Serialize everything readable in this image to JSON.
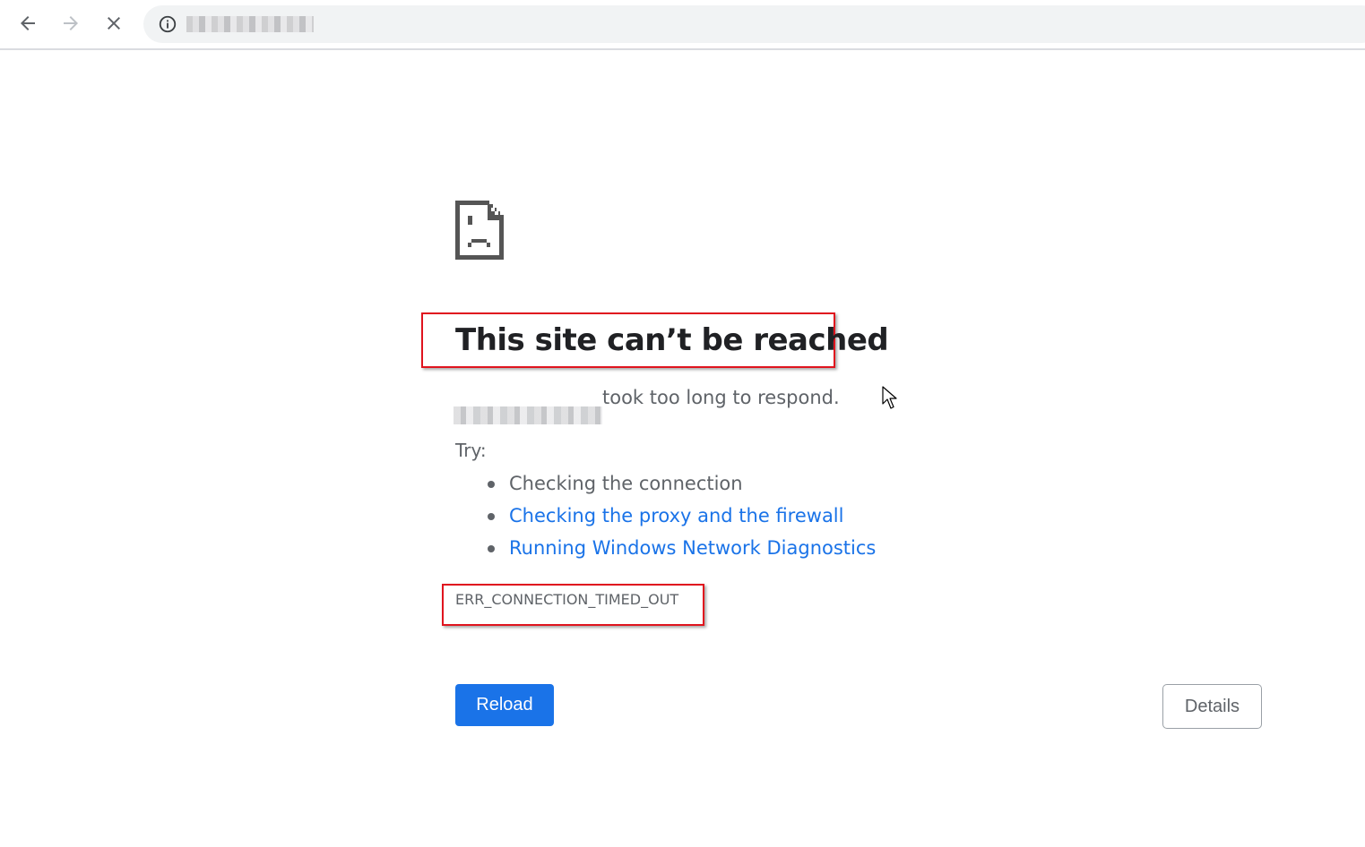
{
  "browser": {
    "back_label": "Back",
    "forward_label": "Forward",
    "stop_label": "Stop loading",
    "url": "(blurred address)",
    "site_info_icon": "info-icon"
  },
  "error_page": {
    "icon": "sad-page-icon",
    "title": "This site can’t be reached",
    "host": "(blurred host)",
    "message": "took too long to respond.",
    "try_label": "Try:",
    "suggestions": [
      {
        "text": "Checking the connection",
        "link": false
      },
      {
        "text": "Checking the proxy and the firewall",
        "link": true
      },
      {
        "text": "Running Windows Network Diagnostics",
        "link": true
      }
    ],
    "error_code": "ERR_CONNECTION_TIMED_OUT",
    "reload_label": "Reload",
    "details_label": "Details"
  },
  "colors": {
    "link": "#1a73e8",
    "primary_button": "#1a73e8",
    "text": "#5f6368",
    "title": "#202124",
    "annotation_box": "#e0141e"
  }
}
